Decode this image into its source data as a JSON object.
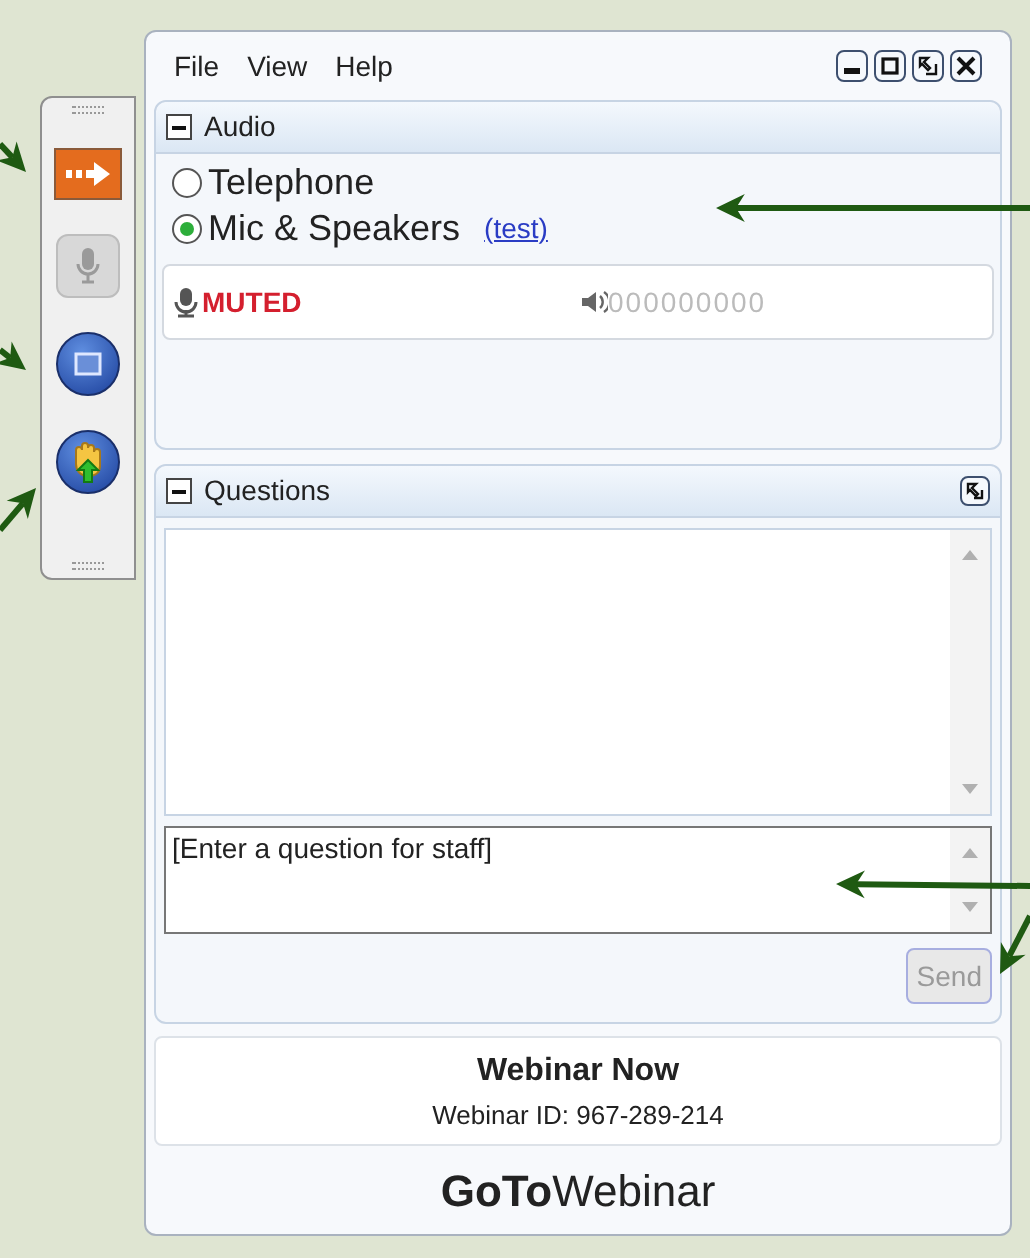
{
  "menu": [
    "File",
    "View",
    "Help"
  ],
  "toolbar": [
    {
      "kind": "arrow",
      "disabled": false
    },
    {
      "kind": "mic",
      "disabled": true
    },
    {
      "kind": "screen",
      "disabled": false
    },
    {
      "kind": "hand",
      "disabled": false
    }
  ],
  "audio": {
    "title": "Audio",
    "expanded": true,
    "options": [
      {
        "label": "Telephone",
        "selected": false
      },
      {
        "label": "Mic & Speakers",
        "selected": true
      }
    ],
    "test_link": "(test)",
    "mic_status": "MUTED",
    "speaker_meter": "000000000"
  },
  "questions": {
    "title": "Questions",
    "expanded": true,
    "placeholder": "[Enter a question for staff]",
    "send": {
      "label": "Send",
      "disabled": true
    }
  },
  "footer": {
    "title": "Webinar Now",
    "webinar_id": "Webinar ID: 967-289-214",
    "logo": "**GoTo**Webinar"
  }
}
